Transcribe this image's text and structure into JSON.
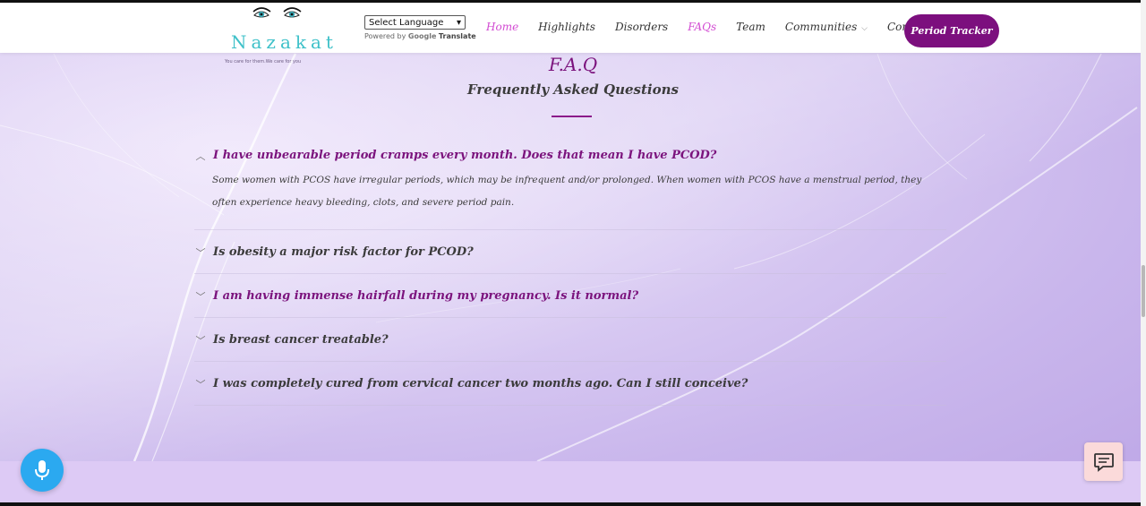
{
  "brand": {
    "name": "Nazakat",
    "tagline": "You care for them.We care for you"
  },
  "translate": {
    "select_value": "Select Language",
    "powered_by": "Powered by",
    "google": "Google",
    "translate_label": "Translate"
  },
  "nav": {
    "items": [
      {
        "label": "Home",
        "active": true
      },
      {
        "label": "Highlights",
        "active": false
      },
      {
        "label": "Disorders",
        "active": false
      },
      {
        "label": "FAQs",
        "active": true
      },
      {
        "label": "Team",
        "active": false
      },
      {
        "label": "Communities",
        "active": false
      },
      {
        "label": "Contact Us",
        "active": false
      }
    ],
    "cta": "Period Tracker"
  },
  "faq": {
    "title": "F.A.Q",
    "subtitle": "Frequently Asked Questions",
    "items": [
      {
        "question": "I have unbearable period cramps every month. Does that mean I have PCOD?",
        "expanded": true,
        "answer": "Some women with PCOS have irregular periods, which may be infrequent and/or prolonged. When women with PCOS have a menstrual period, they often experience heavy bleeding, clots, and severe period pain."
      },
      {
        "question": "Is obesity a major risk factor for PCOD?",
        "expanded": false
      },
      {
        "question": "I am having immense hairfall during my pregnancy. Is it normal?",
        "expanded": false
      },
      {
        "question": "Is breast cancer treatable?",
        "expanded": false
      },
      {
        "question": "I was completely cured from cervical cancer two months ago. Can I still conceive?",
        "expanded": false
      }
    ]
  },
  "colors": {
    "accent": "#7b137d",
    "nav_active": "#d24bd2",
    "mic": "#2ba9f0",
    "chat": "#fbdada",
    "logo_text": "#3fc1c9"
  },
  "icons": {
    "expanded": "chevron-up-icon",
    "collapsed": "chevron-down-icon",
    "mic": "microphone-icon",
    "chat": "chat-icon"
  }
}
